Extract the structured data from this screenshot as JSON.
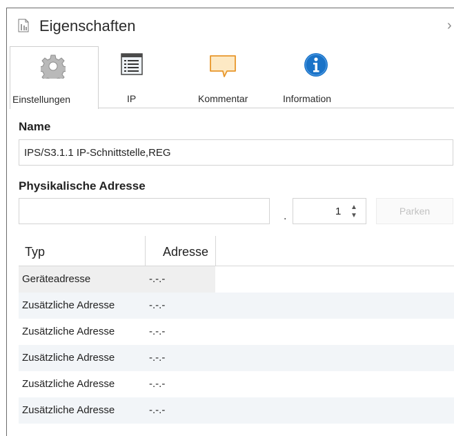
{
  "header": {
    "title": "Eigenschaften",
    "icon": "document-properties-icon",
    "collapse_glyph": "›"
  },
  "tabs": [
    {
      "label": "Einstellungen",
      "icon": "gear-icon",
      "active": true
    },
    {
      "label": "IP",
      "icon": "list-window-icon",
      "active": false
    },
    {
      "label": "Kommentar",
      "icon": "comment-bubble-icon",
      "active": false
    },
    {
      "label": "Information",
      "icon": "info-icon",
      "active": false
    }
  ],
  "name_section": {
    "label": "Name",
    "value": "IPS/S3.1.1 IP-Schnittstelle,REG"
  },
  "address_section": {
    "label": "Physikalische Adresse",
    "prefix_value": "",
    "separator": ".",
    "device_value": "1",
    "spinner_up": "▲",
    "spinner_down": "▼",
    "park_button": "Parken"
  },
  "table": {
    "columns": [
      "Typ",
      "Adresse"
    ],
    "rows": [
      {
        "typ": "Geräteadresse",
        "adresse": "-.-.-"
      },
      {
        "typ": "Zusätzliche Adresse",
        "adresse": "-.-.-"
      },
      {
        "typ": "Zusätzliche Adresse",
        "adresse": "-.-.-"
      },
      {
        "typ": "Zusätzliche Adresse",
        "adresse": "-.-.-"
      },
      {
        "typ": "Zusätzliche Adresse",
        "adresse": "-.-.-"
      },
      {
        "typ": "Zusätzliche Adresse",
        "adresse": "-.-.-"
      }
    ]
  },
  "colors": {
    "info_blue": "#1a73c8",
    "comment_orange": "#e8962a",
    "row_alt": "#f2f5f8"
  }
}
